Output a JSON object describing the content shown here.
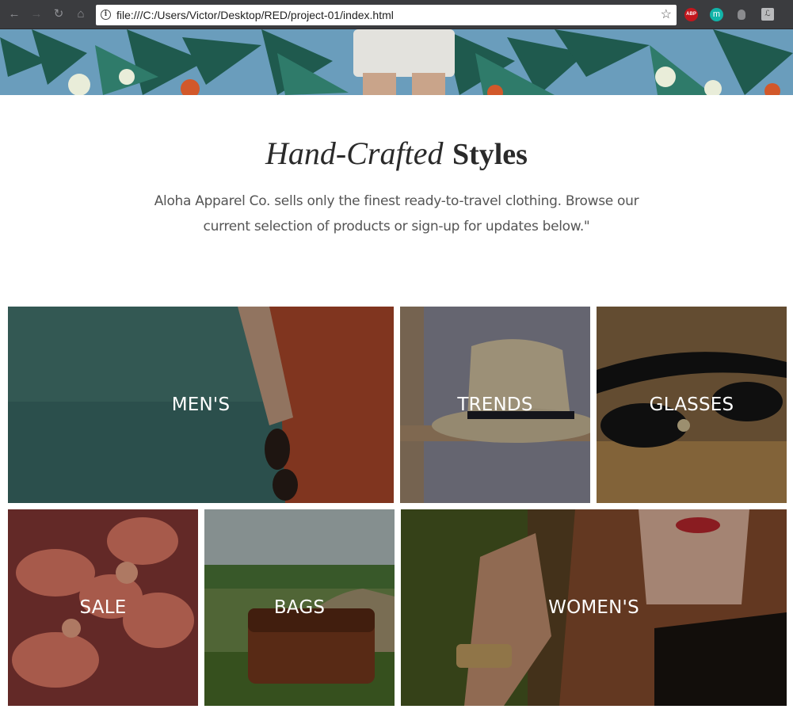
{
  "browser": {
    "url": "file:///C:/Users/Victor/Desktop/RED/project-01/index.html",
    "extensions": [
      {
        "name": "adblock-plus",
        "label": "ABP",
        "color": "#c3171d"
      },
      {
        "name": "mercury",
        "label": "m",
        "color": "#12b3a8"
      },
      {
        "name": "privacy-shield",
        "label": "",
        "color": "#8a8b8e"
      },
      {
        "name": "extension-menu",
        "label": "ℒ",
        "color": "#b9babc"
      }
    ]
  },
  "intro": {
    "title_light": "Hand-Crafted",
    "title_bold": "Styles",
    "description": "Aloha Apparel Co. sells only the finest ready-to-travel clothing. Browse our current selection of products or sign-up for updates below.\""
  },
  "categories": [
    {
      "label": "MEN'S"
    },
    {
      "label": "TRENDS"
    },
    {
      "label": "GLASSES"
    },
    {
      "label": "SALE"
    },
    {
      "label": "BAGS"
    },
    {
      "label": "WOMEN'S"
    }
  ]
}
